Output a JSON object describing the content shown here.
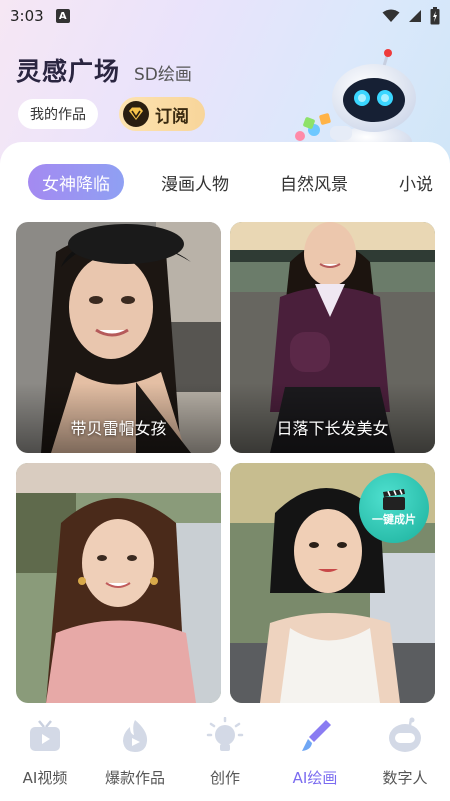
{
  "status_bar": {
    "time": "3:03",
    "notification_letter": "A"
  },
  "header": {
    "title": "灵感广场",
    "subtitle": "SD绘画",
    "my_works_label": "我的作品",
    "subscribe_label": "订阅"
  },
  "tabs": [
    {
      "label": "女神降临",
      "active": true
    },
    {
      "label": "漫画人物",
      "active": false
    },
    {
      "label": "自然风景",
      "active": false
    },
    {
      "label": "小说",
      "active": false
    }
  ],
  "cards": [
    {
      "caption": "带贝雷帽女孩"
    },
    {
      "caption": "日落下长发美女"
    },
    {
      "caption": ""
    },
    {
      "caption": "",
      "badge": "一键成片"
    }
  ],
  "bottom_nav": [
    {
      "label": "AI视频",
      "icon": "tv-icon",
      "active": false
    },
    {
      "label": "爆款作品",
      "icon": "fire-icon",
      "active": false
    },
    {
      "label": "创作",
      "icon": "lightbulb-icon",
      "active": false
    },
    {
      "label": "AI绘画",
      "icon": "paintbrush-icon",
      "active": true
    },
    {
      "label": "数字人",
      "icon": "robot-head-icon",
      "active": false
    }
  ],
  "colors": {
    "accent": "#7b6cf0",
    "tab_active": "#a48af1",
    "badge": "#1bb09c"
  }
}
